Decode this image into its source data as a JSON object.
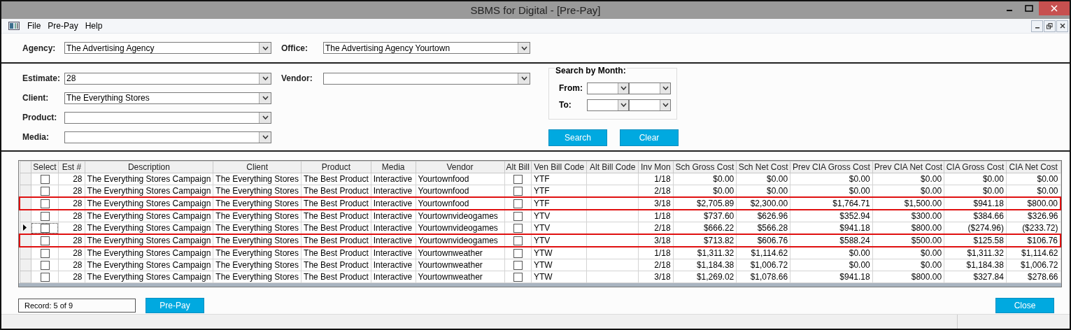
{
  "window": {
    "title": "SBMS for Digital - [Pre-Pay]"
  },
  "menu": [
    "File",
    "Pre-Pay",
    "Help"
  ],
  "agency_fields": [
    {
      "label": "Agency:",
      "value": "The Advertising Agency"
    },
    {
      "label": "Office:",
      "value": "The Advertising Agency Yourtown"
    }
  ],
  "filter_fields": [
    {
      "label": "Estimate:",
      "value": "28"
    },
    {
      "label": "Client:",
      "value": "The Everything Stores"
    },
    {
      "label": "Product:"
    },
    {
      "label": "Media:"
    }
  ],
  "vendor_field": {
    "label": "Vendor:"
  },
  "search_by_month": {
    "title": "Search by Month:",
    "rows": [
      {
        "label": "From:"
      },
      {
        "label": "To:"
      }
    ]
  },
  "filter_buttons": [
    "Search",
    "Clear"
  ],
  "table": {
    "columns": [
      {
        "label": "Select",
        "kind": "check"
      },
      {
        "label": "Est #",
        "kind": "number"
      },
      {
        "label": "Description",
        "kind": "text"
      },
      {
        "label": "Client",
        "kind": "text"
      },
      {
        "label": "Product",
        "kind": "text"
      },
      {
        "label": "Media",
        "kind": "text"
      },
      {
        "label": "Vendor",
        "kind": "text"
      },
      {
        "label": "Alt Bill",
        "kind": "check"
      },
      {
        "label": "Ven Bill Code",
        "kind": "text"
      },
      {
        "label": "Alt Bill Code",
        "kind": "text"
      },
      {
        "label": "Inv Mon",
        "kind": "number"
      },
      {
        "label": "Sch Gross Cost",
        "kind": "number"
      },
      {
        "label": "Sch Net Cost",
        "kind": "number"
      },
      {
        "label": "Prev CIA Gross Cost",
        "kind": "number"
      },
      {
        "label": "Prev CIA Net Cost",
        "kind": "number"
      },
      {
        "label": "CIA Gross Cost",
        "kind": "number"
      },
      {
        "label": "CIA Net Cost",
        "kind": "number"
      }
    ],
    "rows": [
      {
        "select": false,
        "alt_bill": false,
        "current": false,
        "highlighted": false,
        "cells": [
          "",
          "28",
          "The Everything Stores Campaign",
          "The Everything Stores",
          "The Best Product",
          "Interactive",
          "Yourtownfood",
          "",
          "YTF",
          "",
          "1/18",
          "$0.00",
          "$0.00",
          "$0.00",
          "$0.00",
          "$0.00",
          "$0.00"
        ]
      },
      {
        "select": false,
        "alt_bill": false,
        "current": false,
        "highlighted": false,
        "cells": [
          "",
          "28",
          "The Everything Stores Campaign",
          "The Everything Stores",
          "The Best Product",
          "Interactive",
          "Yourtownfood",
          "",
          "YTF",
          "",
          "2/18",
          "$0.00",
          "$0.00",
          "$0.00",
          "$0.00",
          "$0.00",
          "$0.00"
        ]
      },
      {
        "select": false,
        "alt_bill": false,
        "current": false,
        "highlighted": true,
        "cells": [
          "",
          "28",
          "The Everything Stores Campaign",
          "The Everything Stores",
          "The Best Product",
          "Interactive",
          "Yourtownfood",
          "",
          "YTF",
          "",
          "3/18",
          "$2,705.89",
          "$2,300.00",
          "$1,764.71",
          "$1,500.00",
          "$941.18",
          "$800.00"
        ]
      },
      {
        "select": false,
        "alt_bill": false,
        "current": false,
        "highlighted": false,
        "cells": [
          "",
          "28",
          "The Everything Stores Campaign",
          "The Everything Stores",
          "The Best Product",
          "Interactive",
          "Yourtownvideogames",
          "",
          "YTV",
          "",
          "1/18",
          "$737.60",
          "$626.96",
          "$352.94",
          "$300.00",
          "$384.66",
          "$326.96"
        ]
      },
      {
        "select": false,
        "alt_bill": false,
        "current": true,
        "highlighted": false,
        "cells": [
          "",
          "28",
          "The Everything Stores Campaign",
          "The Everything Stores",
          "The Best Product",
          "Interactive",
          "Yourtownvideogames",
          "",
          "YTV",
          "",
          "2/18",
          "$666.22",
          "$566.28",
          "$941.18",
          "$800.00",
          "($274.96)",
          "($233.72)"
        ]
      },
      {
        "select": false,
        "alt_bill": false,
        "current": false,
        "highlighted": true,
        "cells": [
          "",
          "28",
          "The Everything Stores Campaign",
          "The Everything Stores",
          "The Best Product",
          "Interactive",
          "Yourtownvideogames",
          "",
          "YTV",
          "",
          "3/18",
          "$713.82",
          "$606.76",
          "$588.24",
          "$500.00",
          "$125.58",
          "$106.76"
        ]
      },
      {
        "select": false,
        "alt_bill": false,
        "current": false,
        "highlighted": false,
        "cells": [
          "",
          "28",
          "The Everything Stores Campaign",
          "The Everything Stores",
          "The Best Product",
          "Interactive",
          "Yourtownweather",
          "",
          "YTW",
          "",
          "1/18",
          "$1,311.32",
          "$1,114.62",
          "$0.00",
          "$0.00",
          "$1,311.32",
          "$1,114.62"
        ]
      },
      {
        "select": false,
        "alt_bill": false,
        "current": false,
        "highlighted": false,
        "cells": [
          "",
          "28",
          "The Everything Stores Campaign",
          "The Everything Stores",
          "The Best Product",
          "Interactive",
          "Yourtownweather",
          "",
          "YTW",
          "",
          "2/18",
          "$1,184.38",
          "$1,006.72",
          "$0.00",
          "$0.00",
          "$1,184.38",
          "$1,006.72"
        ]
      },
      {
        "select": false,
        "alt_bill": false,
        "current": false,
        "highlighted": false,
        "cells": [
          "",
          "28",
          "The Everything Stores Campaign",
          "The Everything Stores",
          "The Best Product",
          "Interactive",
          "Yourtownweather",
          "",
          "YTW",
          "",
          "3/18",
          "$1,269.02",
          "$1,078.66",
          "$941.18",
          "$800.00",
          "$327.84",
          "$278.66"
        ]
      }
    ]
  },
  "record_indicator": "Record:  5 of 9",
  "footer_buttons": [
    {
      "label": "Pre-Pay",
      "kind": "left"
    },
    {
      "label": "Close",
      "kind": "right"
    }
  ]
}
